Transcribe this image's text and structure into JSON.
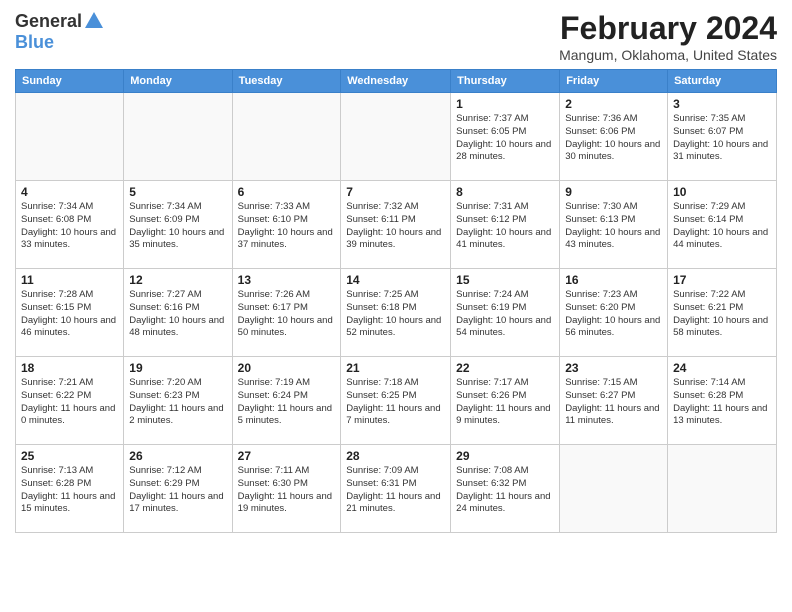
{
  "logo": {
    "general": "General",
    "blue": "Blue"
  },
  "title": "February 2024",
  "subtitle": "Mangum, Oklahoma, United States",
  "days_of_week": [
    "Sunday",
    "Monday",
    "Tuesday",
    "Wednesday",
    "Thursday",
    "Friday",
    "Saturday"
  ],
  "weeks": [
    [
      {
        "day": "",
        "info": ""
      },
      {
        "day": "",
        "info": ""
      },
      {
        "day": "",
        "info": ""
      },
      {
        "day": "",
        "info": ""
      },
      {
        "day": "1",
        "info": "Sunrise: 7:37 AM\nSunset: 6:05 PM\nDaylight: 10 hours and 28 minutes."
      },
      {
        "day": "2",
        "info": "Sunrise: 7:36 AM\nSunset: 6:06 PM\nDaylight: 10 hours and 30 minutes."
      },
      {
        "day": "3",
        "info": "Sunrise: 7:35 AM\nSunset: 6:07 PM\nDaylight: 10 hours and 31 minutes."
      }
    ],
    [
      {
        "day": "4",
        "info": "Sunrise: 7:34 AM\nSunset: 6:08 PM\nDaylight: 10 hours and 33 minutes."
      },
      {
        "day": "5",
        "info": "Sunrise: 7:34 AM\nSunset: 6:09 PM\nDaylight: 10 hours and 35 minutes."
      },
      {
        "day": "6",
        "info": "Sunrise: 7:33 AM\nSunset: 6:10 PM\nDaylight: 10 hours and 37 minutes."
      },
      {
        "day": "7",
        "info": "Sunrise: 7:32 AM\nSunset: 6:11 PM\nDaylight: 10 hours and 39 minutes."
      },
      {
        "day": "8",
        "info": "Sunrise: 7:31 AM\nSunset: 6:12 PM\nDaylight: 10 hours and 41 minutes."
      },
      {
        "day": "9",
        "info": "Sunrise: 7:30 AM\nSunset: 6:13 PM\nDaylight: 10 hours and 43 minutes."
      },
      {
        "day": "10",
        "info": "Sunrise: 7:29 AM\nSunset: 6:14 PM\nDaylight: 10 hours and 44 minutes."
      }
    ],
    [
      {
        "day": "11",
        "info": "Sunrise: 7:28 AM\nSunset: 6:15 PM\nDaylight: 10 hours and 46 minutes."
      },
      {
        "day": "12",
        "info": "Sunrise: 7:27 AM\nSunset: 6:16 PM\nDaylight: 10 hours and 48 minutes."
      },
      {
        "day": "13",
        "info": "Sunrise: 7:26 AM\nSunset: 6:17 PM\nDaylight: 10 hours and 50 minutes."
      },
      {
        "day": "14",
        "info": "Sunrise: 7:25 AM\nSunset: 6:18 PM\nDaylight: 10 hours and 52 minutes."
      },
      {
        "day": "15",
        "info": "Sunrise: 7:24 AM\nSunset: 6:19 PM\nDaylight: 10 hours and 54 minutes."
      },
      {
        "day": "16",
        "info": "Sunrise: 7:23 AM\nSunset: 6:20 PM\nDaylight: 10 hours and 56 minutes."
      },
      {
        "day": "17",
        "info": "Sunrise: 7:22 AM\nSunset: 6:21 PM\nDaylight: 10 hours and 58 minutes."
      }
    ],
    [
      {
        "day": "18",
        "info": "Sunrise: 7:21 AM\nSunset: 6:22 PM\nDaylight: 11 hours and 0 minutes."
      },
      {
        "day": "19",
        "info": "Sunrise: 7:20 AM\nSunset: 6:23 PM\nDaylight: 11 hours and 2 minutes."
      },
      {
        "day": "20",
        "info": "Sunrise: 7:19 AM\nSunset: 6:24 PM\nDaylight: 11 hours and 5 minutes."
      },
      {
        "day": "21",
        "info": "Sunrise: 7:18 AM\nSunset: 6:25 PM\nDaylight: 11 hours and 7 minutes."
      },
      {
        "day": "22",
        "info": "Sunrise: 7:17 AM\nSunset: 6:26 PM\nDaylight: 11 hours and 9 minutes."
      },
      {
        "day": "23",
        "info": "Sunrise: 7:15 AM\nSunset: 6:27 PM\nDaylight: 11 hours and 11 minutes."
      },
      {
        "day": "24",
        "info": "Sunrise: 7:14 AM\nSunset: 6:28 PM\nDaylight: 11 hours and 13 minutes."
      }
    ],
    [
      {
        "day": "25",
        "info": "Sunrise: 7:13 AM\nSunset: 6:28 PM\nDaylight: 11 hours and 15 minutes."
      },
      {
        "day": "26",
        "info": "Sunrise: 7:12 AM\nSunset: 6:29 PM\nDaylight: 11 hours and 17 minutes."
      },
      {
        "day": "27",
        "info": "Sunrise: 7:11 AM\nSunset: 6:30 PM\nDaylight: 11 hours and 19 minutes."
      },
      {
        "day": "28",
        "info": "Sunrise: 7:09 AM\nSunset: 6:31 PM\nDaylight: 11 hours and 21 minutes."
      },
      {
        "day": "29",
        "info": "Sunrise: 7:08 AM\nSunset: 6:32 PM\nDaylight: 11 hours and 24 minutes."
      },
      {
        "day": "",
        "info": ""
      },
      {
        "day": "",
        "info": ""
      }
    ]
  ]
}
